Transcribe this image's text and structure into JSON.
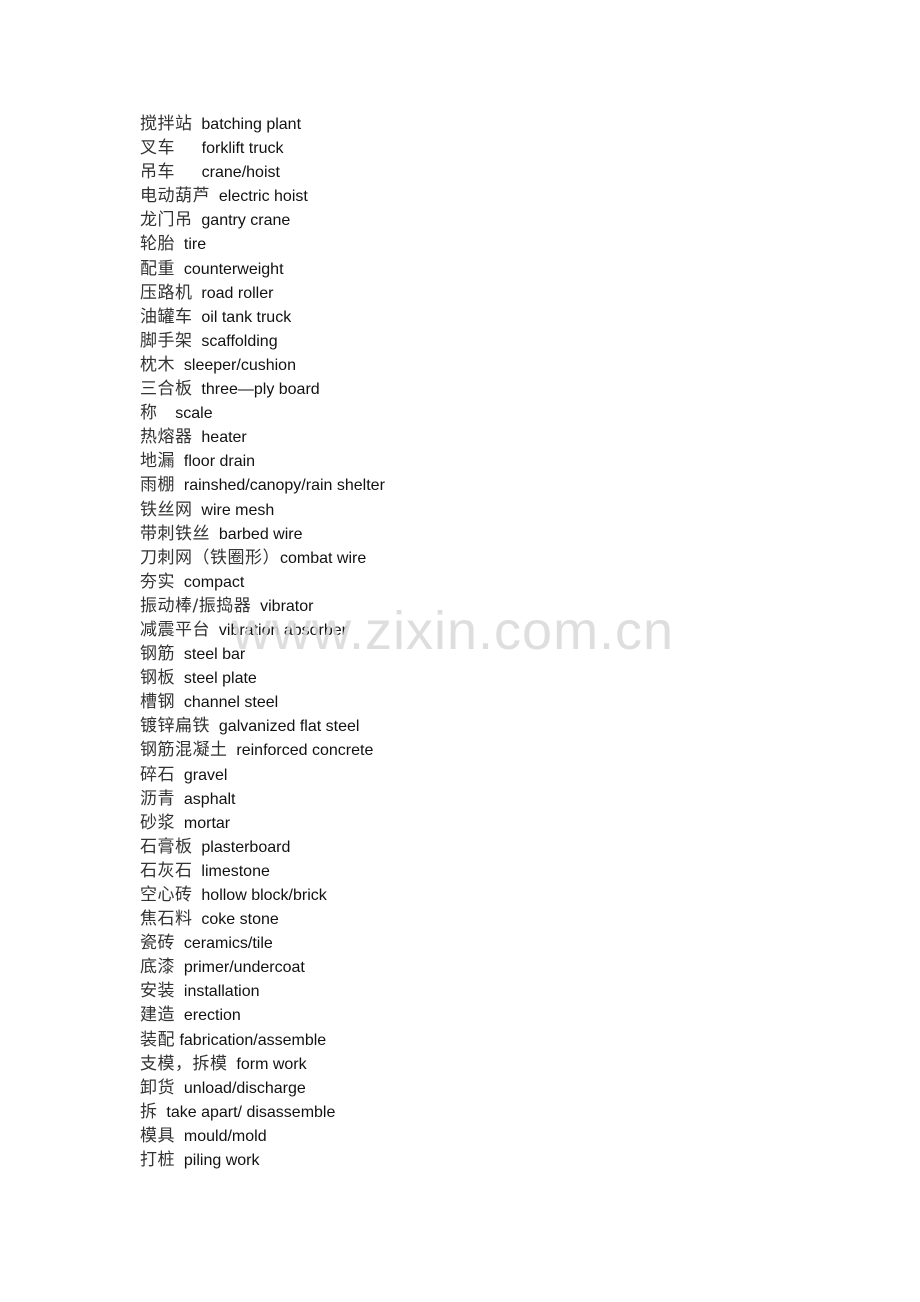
{
  "document": {
    "entries": [
      {
        "zh": "搅拌站",
        "sep": "  ",
        "en": "batching plant"
      },
      {
        "zh": "叉车",
        "sep": "      ",
        "en": "forklift truck"
      },
      {
        "zh": "吊车",
        "sep": "      ",
        "en": "crane/hoist"
      },
      {
        "zh": "电动葫芦",
        "sep": "  ",
        "en": "electric hoist"
      },
      {
        "zh": "龙门吊",
        "sep": "  ",
        "en": "gantry crane"
      },
      {
        "zh": "轮胎",
        "sep": "  ",
        "en": "tire"
      },
      {
        "zh": "配重",
        "sep": "  ",
        "en": "counterweight"
      },
      {
        "zh": "压路机",
        "sep": "  ",
        "en": "road roller"
      },
      {
        "zh": "油罐车",
        "sep": "  ",
        "en": "oil tank truck"
      },
      {
        "zh": "脚手架",
        "sep": "  ",
        "en": "scaffolding"
      },
      {
        "zh": "枕木",
        "sep": "  ",
        "en": "sleeper/cushion"
      },
      {
        "zh": "三合板",
        "sep": "  ",
        "en": "three—ply board"
      },
      {
        "zh": "称",
        "sep": "    ",
        "en": "scale"
      },
      {
        "zh": "热熔器",
        "sep": "  ",
        "en": "heater"
      },
      {
        "zh": "地漏",
        "sep": "  ",
        "en": "floor drain"
      },
      {
        "zh": "雨棚",
        "sep": "  ",
        "en": "rainshed/canopy/rain shelter"
      },
      {
        "zh": "铁丝网",
        "sep": "  ",
        "en": "wire mesh"
      },
      {
        "zh": "带刺铁丝",
        "sep": "  ",
        "en": "barbed wire"
      },
      {
        "zh": "刀刺网（铁圈形）",
        "sep": "",
        "en": "combat wire"
      },
      {
        "zh": "夯实",
        "sep": "  ",
        "en": "compact"
      },
      {
        "zh": "振动棒/振捣器",
        "sep": "  ",
        "en": "vibrator"
      },
      {
        "zh": "减震平台",
        "sep": "  ",
        "en": "vibration absorber"
      },
      {
        "zh": "钢筋",
        "sep": "  ",
        "en": "steel bar"
      },
      {
        "zh": "钢板",
        "sep": "  ",
        "en": "steel plate"
      },
      {
        "zh": "槽钢",
        "sep": "  ",
        "en": "channel steel"
      },
      {
        "zh": "镀锌扁铁",
        "sep": "  ",
        "en": "galvanized flat steel"
      },
      {
        "zh": "钢筋混凝土",
        "sep": "  ",
        "en": "reinforced concrete"
      },
      {
        "zh": "碎石",
        "sep": "  ",
        "en": "gravel"
      },
      {
        "zh": "沥青",
        "sep": "  ",
        "en": "asphalt"
      },
      {
        "zh": "砂浆",
        "sep": "  ",
        "en": "mortar"
      },
      {
        "zh": "石膏板",
        "sep": "  ",
        "en": "plasterboard"
      },
      {
        "zh": "石灰石",
        "sep": "  ",
        "en": "limestone"
      },
      {
        "zh": "空心砖",
        "sep": "  ",
        "en": "hollow block/brick"
      },
      {
        "zh": "焦石料",
        "sep": "  ",
        "en": "coke stone"
      },
      {
        "zh": "瓷砖",
        "sep": "  ",
        "en": "ceramics/tile"
      },
      {
        "zh": "底漆",
        "sep": "  ",
        "en": "primer/undercoat"
      },
      {
        "zh": "安装",
        "sep": "  ",
        "en": "installation"
      },
      {
        "zh": "建造",
        "sep": "  ",
        "en": "erection"
      },
      {
        "zh": "装配",
        "sep": " ",
        "en": "fabrication/assemble"
      },
      {
        "zh": "支模，拆模",
        "sep": "  ",
        "en": "form work"
      },
      {
        "zh": "卸货",
        "sep": "  ",
        "en": "unload/discharge"
      },
      {
        "zh": "拆",
        "sep": "  ",
        "en": "take apart/ disassemble"
      },
      {
        "zh": "模具",
        "sep": "  ",
        "en": "mould/mold"
      },
      {
        "zh": "打桩",
        "sep": "  ",
        "en": "piling work"
      }
    ]
  },
  "watermark": {
    "text": "www.zixin.com.cn",
    "color": "#d9d9d9"
  }
}
